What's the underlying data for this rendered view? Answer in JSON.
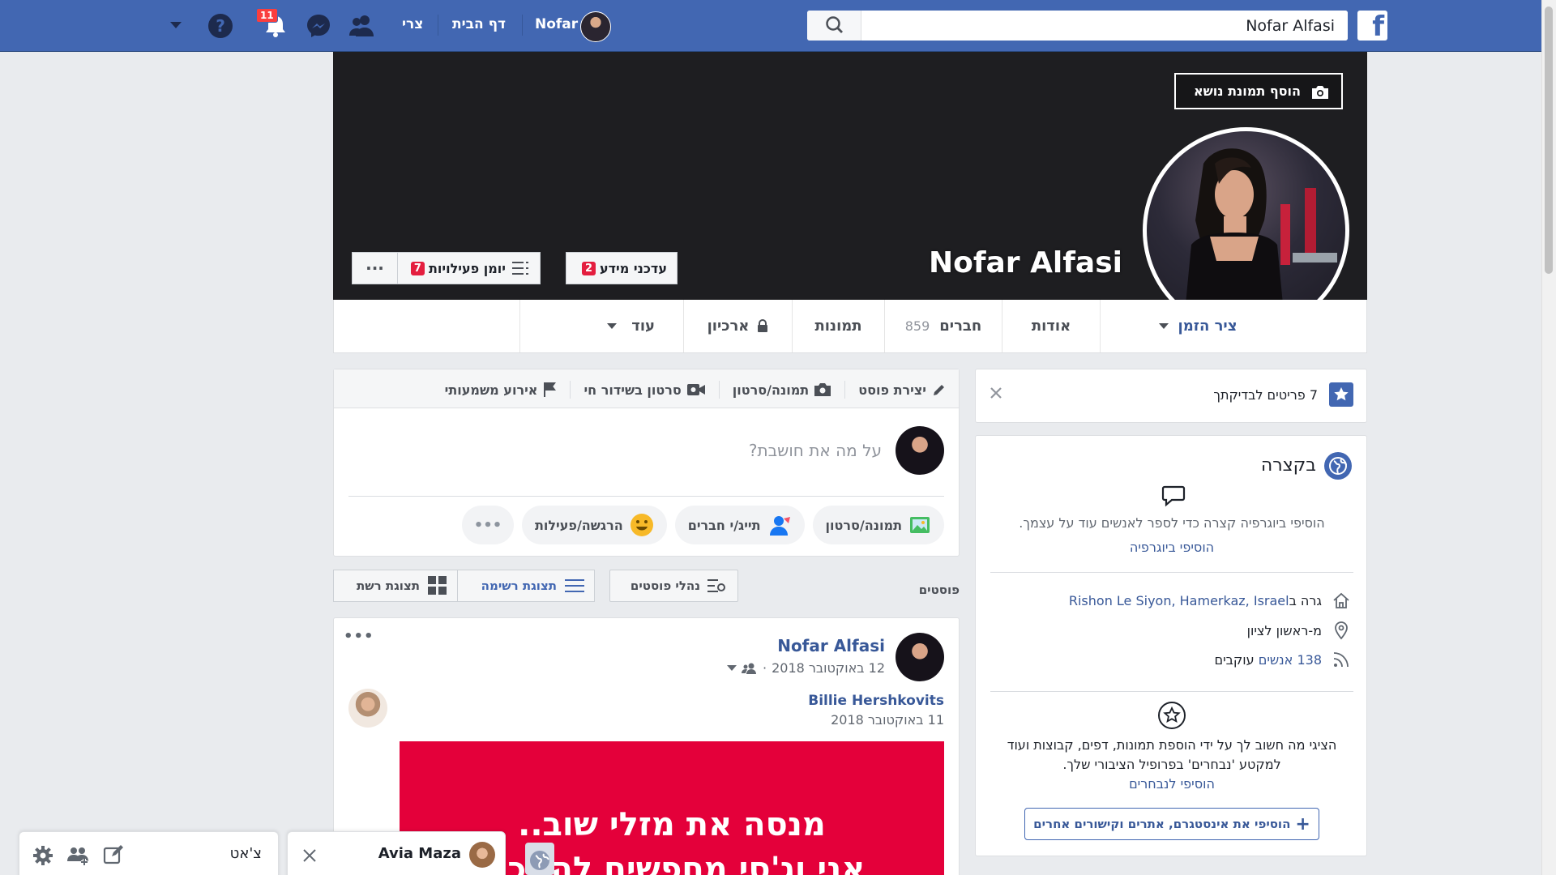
{
  "topbar": {
    "search_value": "Nofar Alfasi",
    "user_name": "Nofar",
    "home_label": "דף הבית",
    "create_label": "צרי",
    "notifications_count": "11",
    "brand_color": "#4267b2"
  },
  "cover": {
    "add_cover_label": "הוסף תמונת נושא",
    "profile_name": "Nofar Alfasi",
    "info_updates_label": "עדכני מידע",
    "info_updates_count": "2",
    "activity_log_label": "יומן פעילויות",
    "activity_log_count": "7",
    "more_dots": "···"
  },
  "tabs": {
    "timeline": "ציר הזמן",
    "about": "אודות",
    "friends": "חברים",
    "friends_count": "859",
    "photos": "תמונות",
    "archive": "ארכיון",
    "more": "עוד"
  },
  "left": {
    "review_items": "7 פריטים לבדיקתך",
    "intro_title": "בקצרה",
    "bio_prompt": "הוסיפי ביוגרפיה קצרה כדי לספר לאנשים עוד על עצמך.",
    "add_bio": "הוסיפי ביוגרפיה",
    "lives_in_prefix": "גרה ב",
    "lives_in": "Rishon Le Siyon, Hamerkaz, Israel",
    "from": "מ-ראשון לציון",
    "followers_link": "138 אנשים",
    "followers_suffix": "עוקבים",
    "featured_text": "הציגי מה חשוב לך על ידי הוספת תמונות, דפים, קבוצות ועוד למקטע 'נבחרים' בפרופיל הציבורי שלך.",
    "add_featured": "הוסיפי לנבחרים",
    "add_links": "הוסיפי את אינסטגרם, אתרים וקישורים אחרים"
  },
  "composer": {
    "create_post": "יצירת פוסט",
    "photo_video": "תמונה/סרטון",
    "live_video": "סרטון בשידור חי",
    "life_event": "אירוע משמעותי",
    "placeholder": "על מה את חושבת?",
    "btn_photo": "תמונה/סרטון",
    "btn_tag": "תייג/י חברים",
    "btn_feeling": "הרגשה/פעילות",
    "btn_more": "•••"
  },
  "posts_bar": {
    "title": "פוסטים",
    "manage": "נהלי פוסטים",
    "list_view": "תצוגת רשימה",
    "grid_view": "תצוגת רשת"
  },
  "post": {
    "author": "Nofar Alfasi",
    "date": "12 באוקטובר 2018",
    "shared_author": "Billie Hershkovits",
    "shared_date": "11 באוקטובר 2018",
    "image_line1": "מנסה את מזלי שוב..",
    "image_line2": "אני וג'סי מחפשים להשכיר",
    "image_color": "#e4003a",
    "more_dots": "•••"
  },
  "chat": {
    "title": "צ'אט",
    "contact": "Avia Maza"
  }
}
